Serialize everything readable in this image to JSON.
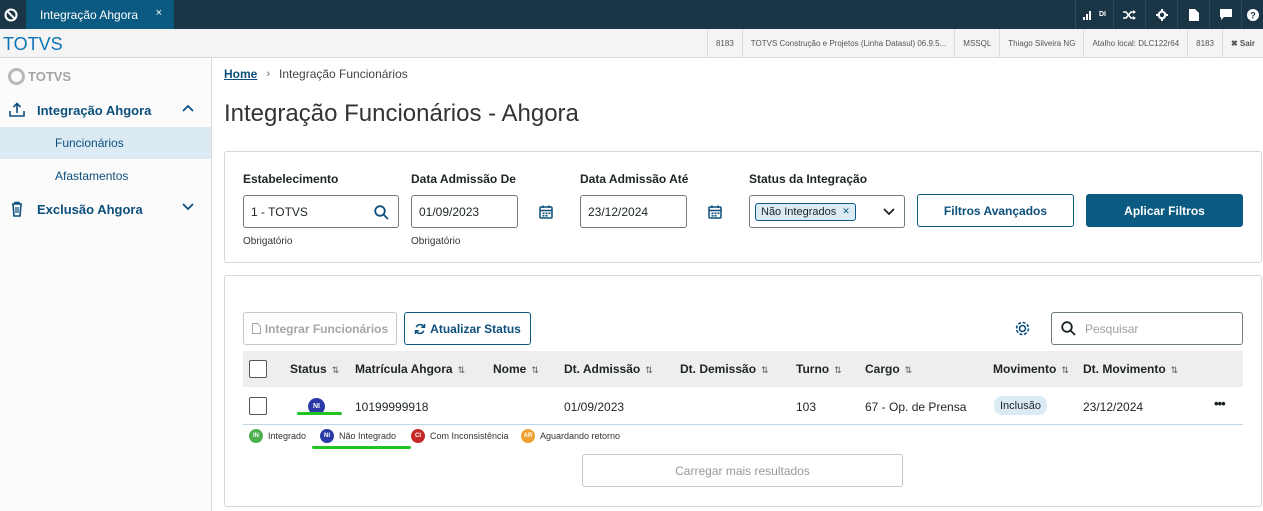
{
  "topbar": {
    "tab_label": "Integração Ahgora",
    "tab_close": "×",
    "icons": [
      "signal-di-icon",
      "shuffle-icon",
      "gear-icon",
      "document-icon",
      "chat-icon",
      "help-icon"
    ],
    "signal_text": "DI"
  },
  "infobar": {
    "brand": "TOTVS",
    "items": [
      "8183",
      "TOTVS Construção e Projetos (Linha Datasul) 06.9.5...",
      "MSSQL",
      "Thiago Silveira NG",
      "Atalho local: DLC122r64",
      "8183",
      "✖ Sair"
    ]
  },
  "sidebar": {
    "logo": "TOTVS",
    "groups": [
      {
        "label": "Integração Ahgora",
        "icon": "upload-icon",
        "expanded": true
      },
      {
        "label": "Exclusão Ahgora",
        "icon": "trash-icon",
        "expanded": false
      }
    ],
    "items": [
      {
        "label": "Funcionários",
        "active": true
      },
      {
        "label": "Afastamentos",
        "active": false
      }
    ]
  },
  "breadcrumb": {
    "home": "Home",
    "current": "Integração Funcionários"
  },
  "page_title": "Integração Funcionários - Ahgora",
  "filters": {
    "estabelecimento": {
      "label": "Estabelecimento",
      "value": "1 - TOTVS",
      "help": "Obrigatório"
    },
    "data_de": {
      "label": "Data Admissão De",
      "value": "01/09/2023",
      "help": "Obrigatório"
    },
    "data_ate": {
      "label": "Data Admissão Até",
      "value": "23/12/2024"
    },
    "status": {
      "label": "Status da Integração",
      "chip": "Não Integrados"
    },
    "advanced_button": "Filtros Avançados",
    "apply_button": "Aplicar Filtros"
  },
  "results": {
    "integrar_button": "Integrar Funcionários",
    "atualizar_button": "Atualizar Status",
    "search_placeholder": "Pesquisar",
    "columns": [
      "Status",
      "Matrícula Ahgora",
      "Nome",
      "Dt. Admissão",
      "Dt. Demissão",
      "Turno",
      "Cargo",
      "Movimento",
      "Dt. Movimento"
    ],
    "rows": [
      {
        "status": "NI",
        "matricula": "10199999918",
        "nome": "",
        "dt_admissao": "01/09/2023",
        "dt_demissao": "",
        "turno": "103",
        "cargo": "67 - Op. de Prensa",
        "movimento": "Inclusão",
        "dt_movimento": "23/12/2024",
        "actions": "•••"
      }
    ],
    "legend": [
      {
        "code": "IN",
        "label": "Integrado",
        "color": "#4caf50"
      },
      {
        "code": "NI",
        "label": "Não Integrado",
        "color": "#2b3aa8"
      },
      {
        "code": "CI",
        "label": "Com Inconsistência",
        "color": "#c62828"
      },
      {
        "code": "AR",
        "label": "Aguardando retorno",
        "color": "#f0a030"
      }
    ],
    "load_more": "Carregar mais resultados"
  },
  "colors": {
    "primary": "#0b5a82",
    "topbar": "#1a3545",
    "highlight": "#21c421"
  }
}
